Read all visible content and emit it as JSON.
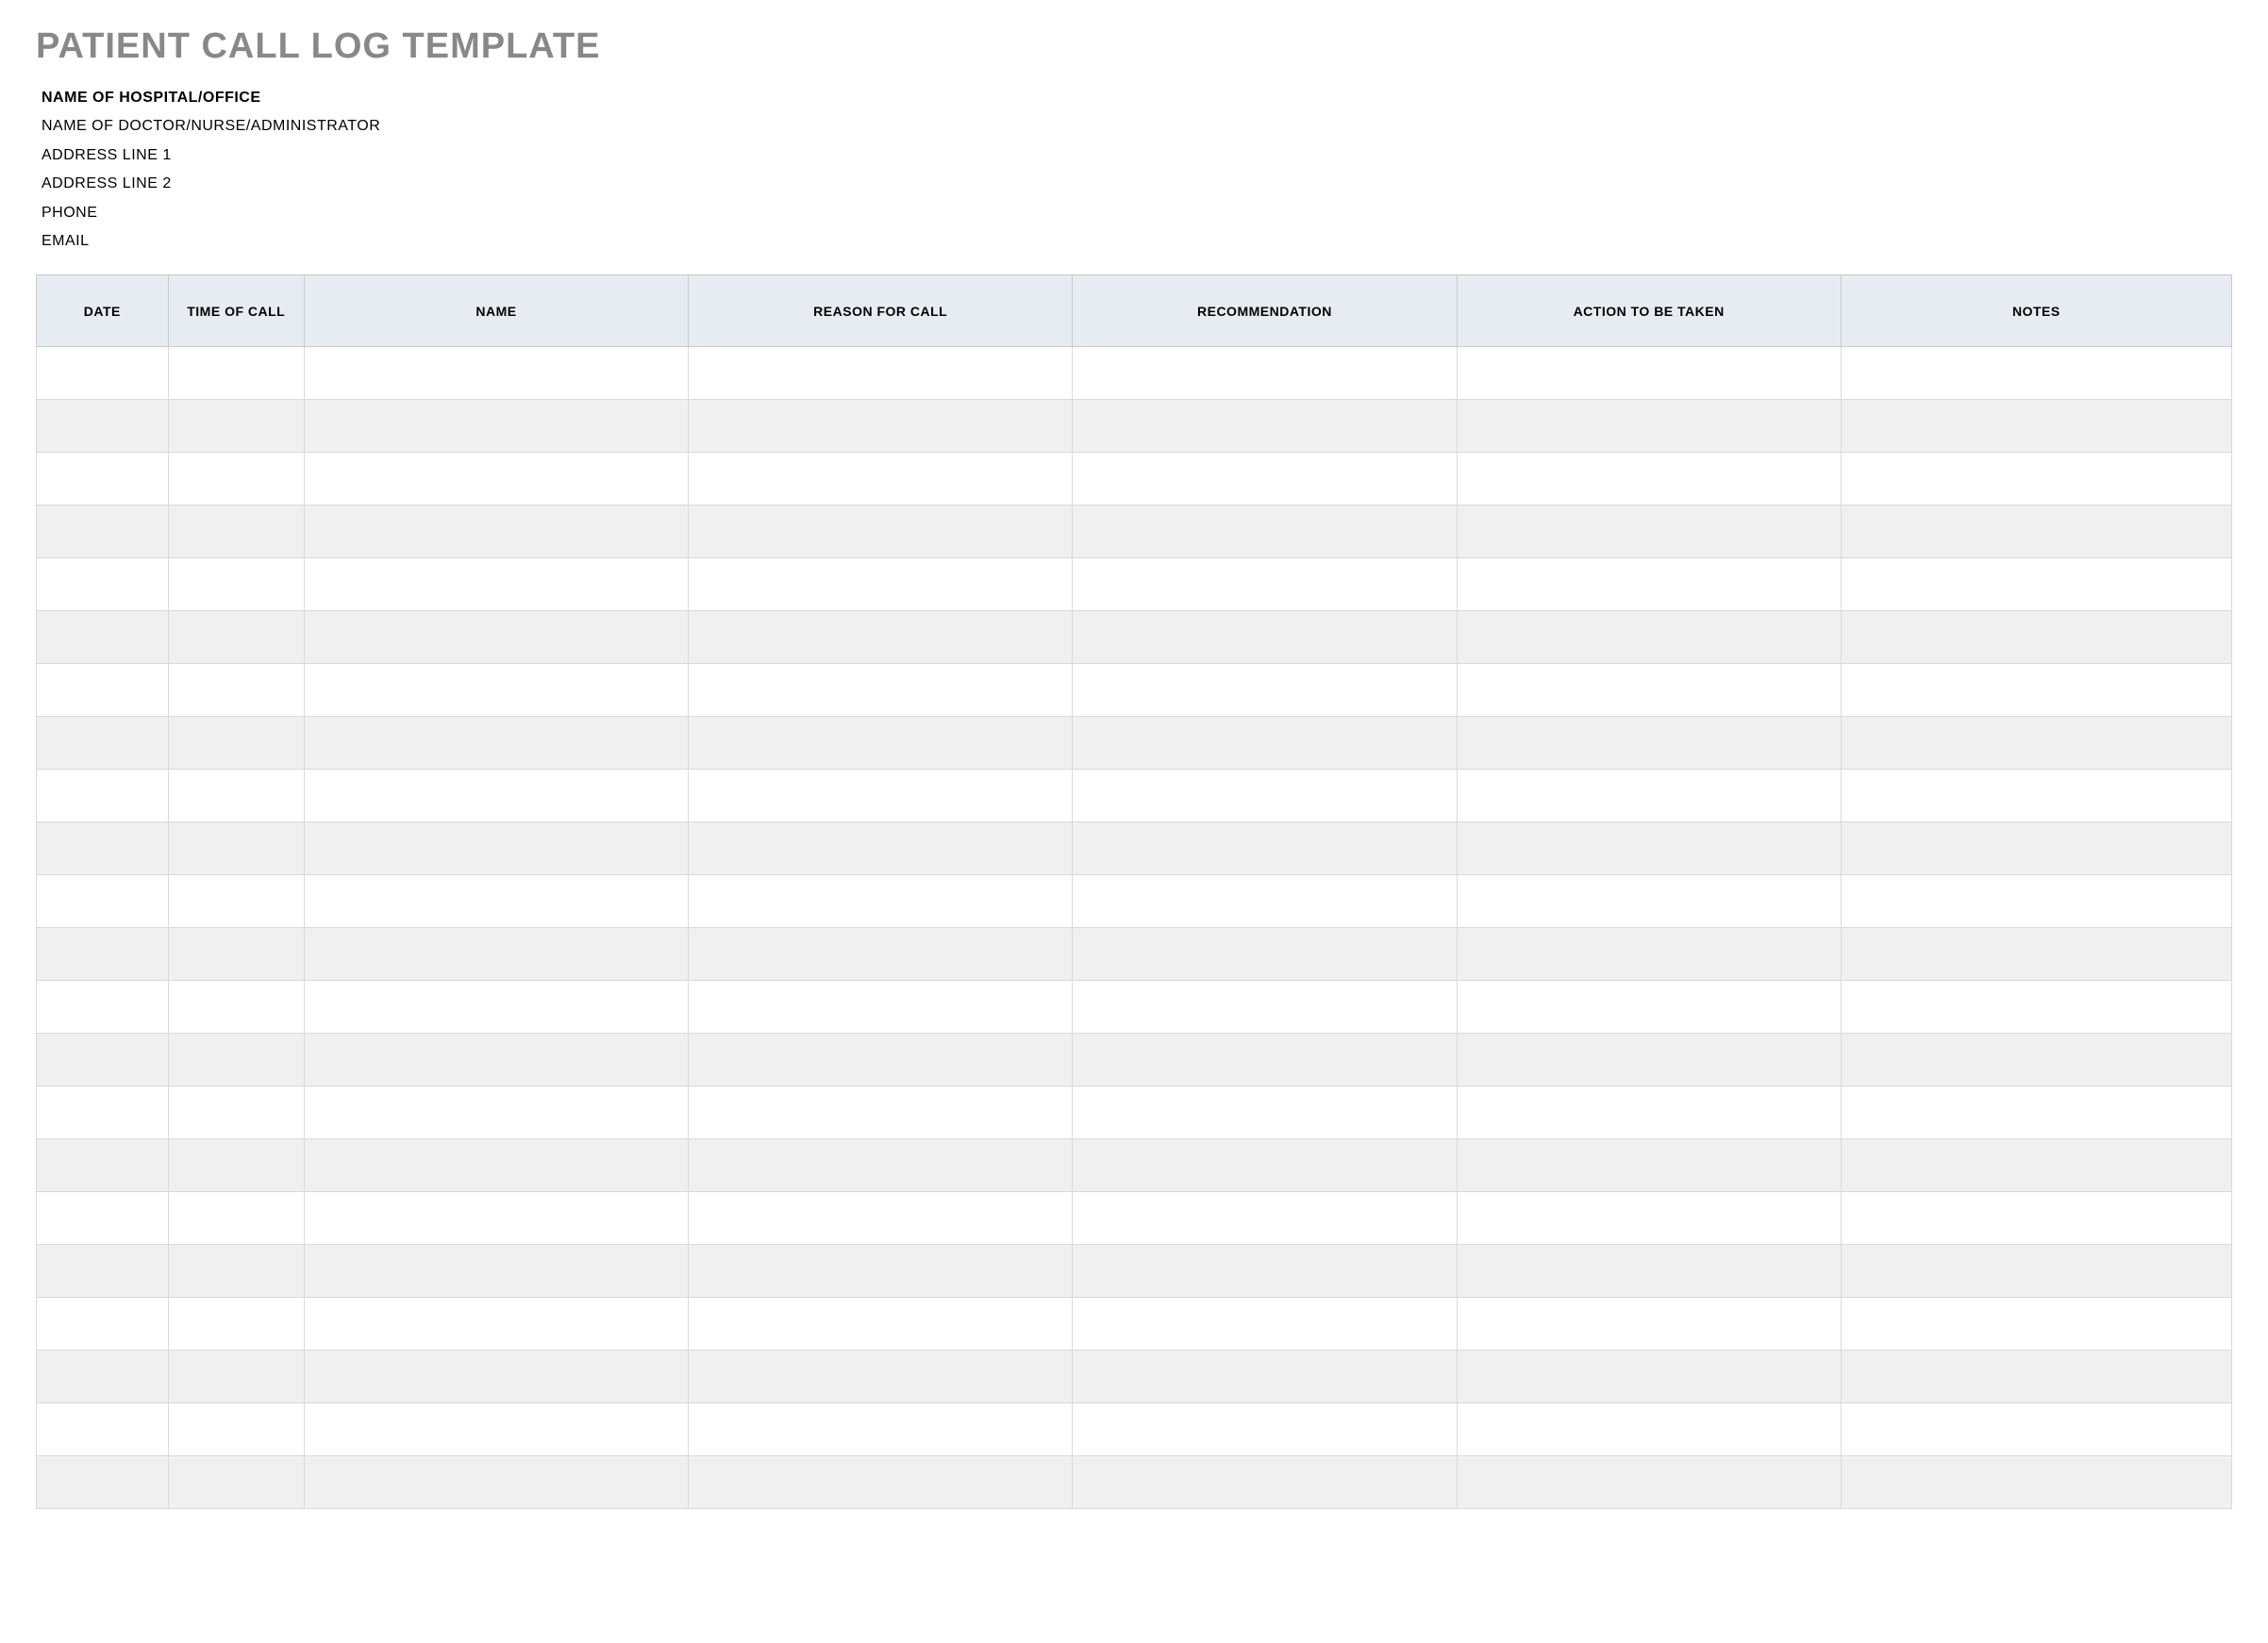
{
  "title": "PATIENT CALL LOG TEMPLATE",
  "header": {
    "hospital": "NAME OF HOSPITAL/OFFICE",
    "admin": "NAME OF DOCTOR/NURSE/ADMINISTRATOR",
    "address1": "ADDRESS LINE 1",
    "address2": "ADDRESS LINE 2",
    "phone": "PHONE",
    "email": "EMAIL"
  },
  "table": {
    "columns": [
      "DATE",
      "TIME OF CALL",
      "NAME",
      "REASON FOR CALL",
      "RECOMMENDATION",
      "ACTION TO BE TAKEN",
      "NOTES"
    ],
    "rows": [
      [
        "",
        "",
        "",
        "",
        "",
        "",
        ""
      ],
      [
        "",
        "",
        "",
        "",
        "",
        "",
        ""
      ],
      [
        "",
        "",
        "",
        "",
        "",
        "",
        ""
      ],
      [
        "",
        "",
        "",
        "",
        "",
        "",
        ""
      ],
      [
        "",
        "",
        "",
        "",
        "",
        "",
        ""
      ],
      [
        "",
        "",
        "",
        "",
        "",
        "",
        ""
      ],
      [
        "",
        "",
        "",
        "",
        "",
        "",
        ""
      ],
      [
        "",
        "",
        "",
        "",
        "",
        "",
        ""
      ],
      [
        "",
        "",
        "",
        "",
        "",
        "",
        ""
      ],
      [
        "",
        "",
        "",
        "",
        "",
        "",
        ""
      ],
      [
        "",
        "",
        "",
        "",
        "",
        "",
        ""
      ],
      [
        "",
        "",
        "",
        "",
        "",
        "",
        ""
      ],
      [
        "",
        "",
        "",
        "",
        "",
        "",
        ""
      ],
      [
        "",
        "",
        "",
        "",
        "",
        "",
        ""
      ],
      [
        "",
        "",
        "",
        "",
        "",
        "",
        ""
      ],
      [
        "",
        "",
        "",
        "",
        "",
        "",
        ""
      ],
      [
        "",
        "",
        "",
        "",
        "",
        "",
        ""
      ],
      [
        "",
        "",
        "",
        "",
        "",
        "",
        ""
      ],
      [
        "",
        "",
        "",
        "",
        "",
        "",
        ""
      ],
      [
        "",
        "",
        "",
        "",
        "",
        "",
        ""
      ],
      [
        "",
        "",
        "",
        "",
        "",
        "",
        ""
      ],
      [
        "",
        "",
        "",
        "",
        "",
        "",
        ""
      ]
    ]
  }
}
